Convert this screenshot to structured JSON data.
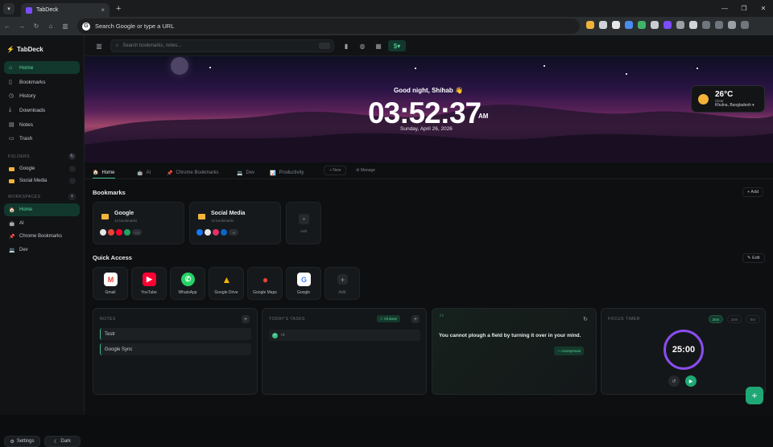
{
  "browser": {
    "tab_title": "TabDeck",
    "omnibox_placeholder": "Search Google or type a URL"
  },
  "sidebar": {
    "brand": "TabDeck",
    "nav": [
      {
        "label": "Home",
        "icon": "home-icon"
      },
      {
        "label": "Bookmarks",
        "icon": "bookmark-icon"
      },
      {
        "label": "History",
        "icon": "history-icon"
      },
      {
        "label": "Downloads",
        "icon": "download-icon"
      },
      {
        "label": "Notes",
        "icon": "note-icon"
      },
      {
        "label": "Trash",
        "icon": "trash-icon"
      }
    ],
    "folders_label": "FOLDERS",
    "folders": [
      {
        "label": "Google"
      },
      {
        "label": "Social Media"
      }
    ],
    "workspaces_label": "WORKSPACES",
    "workspaces": [
      {
        "label": "Home"
      },
      {
        "label": "AI"
      },
      {
        "label": "Chrome Bookmarks"
      },
      {
        "label": "Dev"
      }
    ],
    "settings_label": "Settings",
    "theme_label": "Dark"
  },
  "topbar": {
    "search_placeholder": "Search bookmarks, notes..."
  },
  "hero": {
    "greeting": "Good night, Shihab 👋",
    "time": "03:52:37",
    "ampm": "AM",
    "date": "Sunday, April 26, 2026"
  },
  "weather": {
    "temp": "26°C",
    "condition": "Clear",
    "location": "Khulna, Bangladesh ▾"
  },
  "workspace_tabs": [
    {
      "label": "Home"
    },
    {
      "label": "AI"
    },
    {
      "label": "Chrome Bookmarks"
    },
    {
      "label": "Dev"
    },
    {
      "label": "Productivity"
    }
  ],
  "workspace_actions": {
    "new": "+ New",
    "manage": "⚙ Manage"
  },
  "bookmarks": {
    "title": "Bookmarks",
    "add_label": "+ Add",
    "folders": [
      {
        "name": "Google",
        "count": "14 bookmarks",
        "more": "+10"
      },
      {
        "name": "Social Media",
        "count": "12 bookmarks",
        "more": "+8"
      }
    ],
    "add_card_label": "Add"
  },
  "quick_access": {
    "title": "Quick Access",
    "edit_label": "✎ Edit",
    "items": [
      {
        "label": "Gmail",
        "icon": "gmail-icon",
        "color": "#ffffff"
      },
      {
        "label": "YouTube",
        "icon": "youtube-icon",
        "color": "#ff0033"
      },
      {
        "label": "WhatsApp",
        "icon": "whatsapp-icon",
        "color": "#25d366"
      },
      {
        "label": "Google Drive",
        "icon": "google-drive-icon",
        "color": "#1fa463"
      },
      {
        "label": "Google Maps",
        "icon": "google-maps-icon",
        "color": "#ea4335"
      },
      {
        "label": "Google",
        "icon": "google-icon",
        "color": "#ffffff"
      }
    ],
    "add_label": "Add"
  },
  "notes": {
    "title": "NOTES",
    "items": [
      "Testr",
      "Google Sync"
    ]
  },
  "tasks": {
    "title": "TODAY'S TASKS",
    "badge": "✓ All done",
    "items": [
      "rd"
    ]
  },
  "quote": {
    "text": "You cannot plough a field by turning it over in your mind.",
    "author": "— Anonymous"
  },
  "timer": {
    "title": "FOCUS TIMER",
    "durations": [
      "25m",
      "15m",
      "5m"
    ],
    "time": "25:00"
  }
}
